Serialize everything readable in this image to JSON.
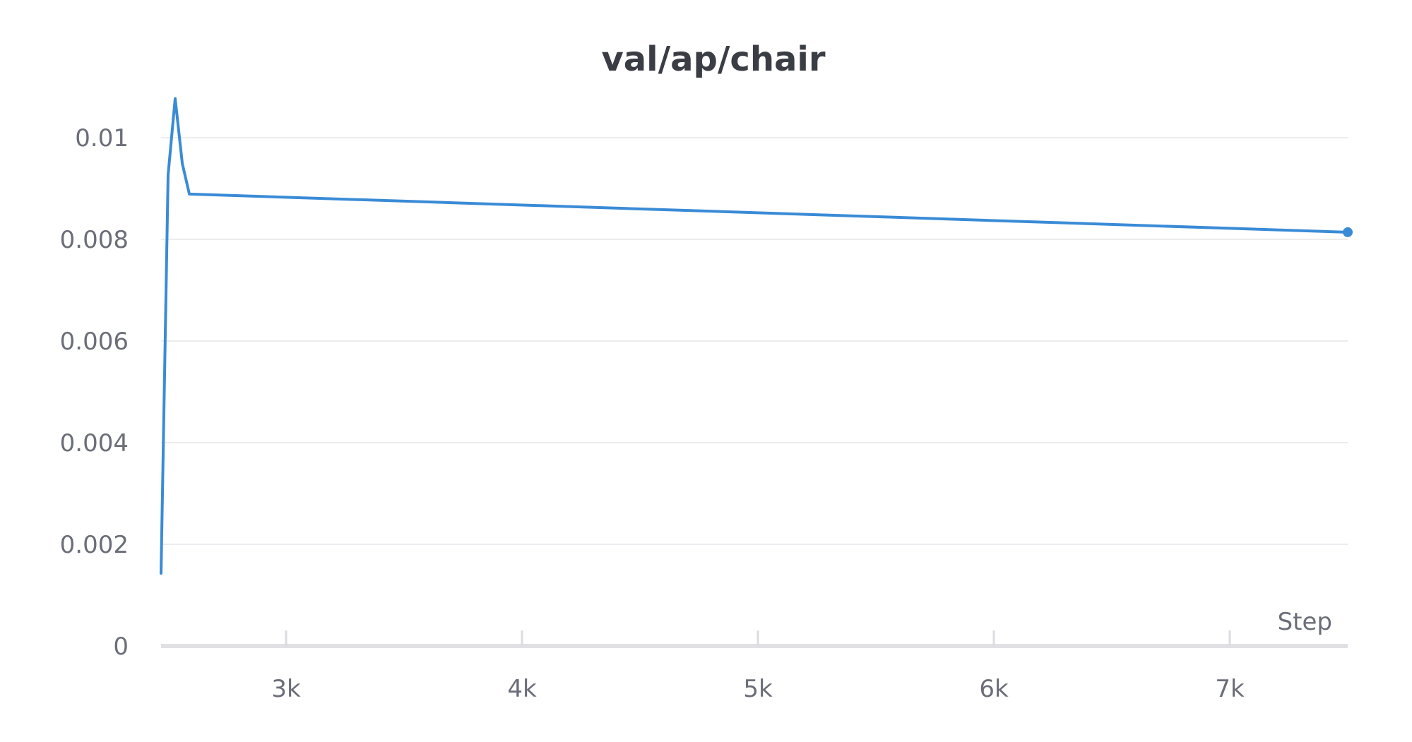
{
  "chart_data": {
    "type": "line",
    "title": "val/ap/chair",
    "xlabel": "Step",
    "ylabel": "",
    "xlim": [
      2470,
      7500
    ],
    "ylim": [
      0,
      0.0108
    ],
    "x_ticks": [
      3000,
      4000,
      5000,
      6000,
      7000
    ],
    "x_tick_labels": [
      "3k",
      "4k",
      "5k",
      "6k",
      "7k"
    ],
    "y_ticks": [
      0,
      0.002,
      0.004,
      0.006,
      0.008,
      0.01
    ],
    "y_tick_labels": [
      "0",
      "0.002",
      "0.004",
      "0.006",
      "0.008",
      "0.01"
    ],
    "grid": true,
    "series": [
      {
        "color": "#3a8bd6",
        "x": [
          2470,
          2500,
          2530,
          2560,
          2590,
          7500
        ],
        "y": [
          0.00143,
          0.00927,
          0.01077,
          0.00949,
          0.00889,
          0.00814
        ]
      }
    ]
  }
}
